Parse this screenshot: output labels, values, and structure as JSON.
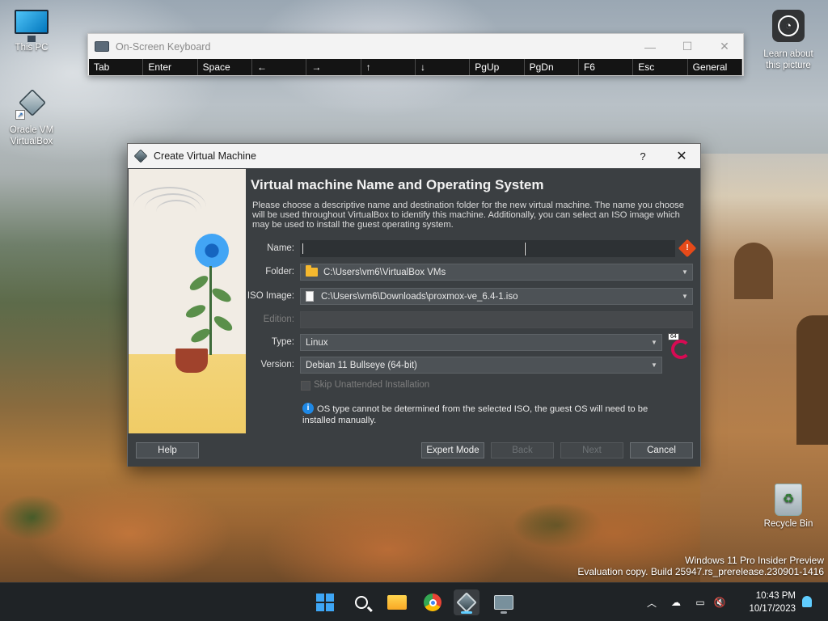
{
  "desktop": {
    "icons": [
      {
        "label": "This PC"
      },
      {
        "label": "Oracle VM VirtualBox"
      },
      {
        "label": "Learn about this picture"
      },
      {
        "label": "Recycle Bin"
      }
    ],
    "watermark": {
      "line1": "Windows 11 Pro Insider Preview",
      "line2": "Evaluation copy. Build 25947.rs_prerelease.230901-1416"
    }
  },
  "osk": {
    "title": "On-Screen Keyboard",
    "keys": [
      "Tab",
      "Enter",
      "Space",
      "←",
      "→",
      "↑",
      "↓",
      "PgUp",
      "PgDn",
      "F6",
      "Esc",
      "General"
    ]
  },
  "dialog": {
    "title": "Create Virtual Machine",
    "help_glyph": "?",
    "close_glyph": "✕",
    "heading": "Virtual machine Name and Operating System",
    "description": "Please choose a descriptive name and destination folder for the new virtual machine. The name you choose will be used throughout VirtualBox to identify this machine. Additionally, you can select an ISO image which may be used to install the guest operating system.",
    "fields": {
      "name_label": "Name:",
      "name_value": "",
      "folder_label": "Folder:",
      "folder_value": "C:\\Users\\vm6\\VirtualBox VMs",
      "iso_label": "ISO Image:",
      "iso_value": "C:\\Users\\vm6\\Downloads\\proxmox-ve_6.4-1.iso",
      "edition_label": "Edition:",
      "edition_value": "",
      "type_label": "Type:",
      "type_value": "Linux",
      "version_label": "Version:",
      "version_value": "Debian 11 Bullseye (64-bit)",
      "os_badge": "64"
    },
    "skip_unattended_label": "Skip Unattended Installation",
    "info_note": "OS type cannot be determined from the selected ISO, the guest OS will need to be installed manually.",
    "buttons": {
      "help": "Help",
      "expert_mode": "Expert Mode",
      "back": "Back",
      "next": "Next",
      "cancel": "Cancel"
    }
  },
  "taskbar": {
    "apps": [
      "start",
      "search",
      "file-explorer",
      "chrome",
      "virtualbox",
      "on-screen-keyboard"
    ],
    "tray": {
      "chevron": "︿",
      "time": "10:43 PM",
      "date": "10/17/2023"
    }
  },
  "colors": {
    "dialog_bg": "#3b3f42",
    "field_bg": "#2d3134",
    "accent": "#60cdff",
    "warning": "#e64a19"
  }
}
